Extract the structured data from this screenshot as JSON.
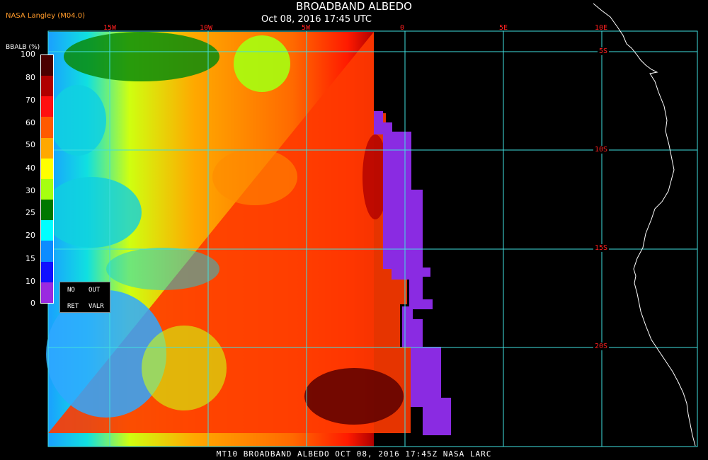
{
  "header": {
    "title": "BROADBAND ALBEDO",
    "subtitle": "Oct 08, 2016 17:45 UTC",
    "producer": "NASA Langley (M04.0)"
  },
  "longitude_labels": [
    "15W",
    "10W",
    "5W",
    "0",
    "5E",
    "10E"
  ],
  "latitude_labels": [
    "5S",
    "10S",
    "15S",
    "20S"
  ],
  "legend": {
    "title": "BBALB (%)",
    "ticks": [
      "100",
      "80",
      "70",
      "60",
      "50",
      "40",
      "30",
      "25",
      "20",
      "15",
      "10",
      "0"
    ],
    "colors": [
      "#4a0000",
      "#b00000",
      "#ff1010",
      "#ff5a00",
      "#ffa800",
      "#ffff00",
      "#a6ff10",
      "#007800",
      "#00ffff",
      "#0c8cff",
      "#1010ff",
      "#9a2ae0"
    ],
    "no_data": [
      "NO",
      "OUT",
      "RET",
      "VALR"
    ]
  },
  "footer": "MT10  BROADBAND ALBEDO  OCT 08, 2016 17:45Z  NASA LARC",
  "colors": {
    "grid": "#40e0e0",
    "label_red": "#ff2020",
    "coast": "#ffffff",
    "out_of_range": "#8a2be2"
  }
}
